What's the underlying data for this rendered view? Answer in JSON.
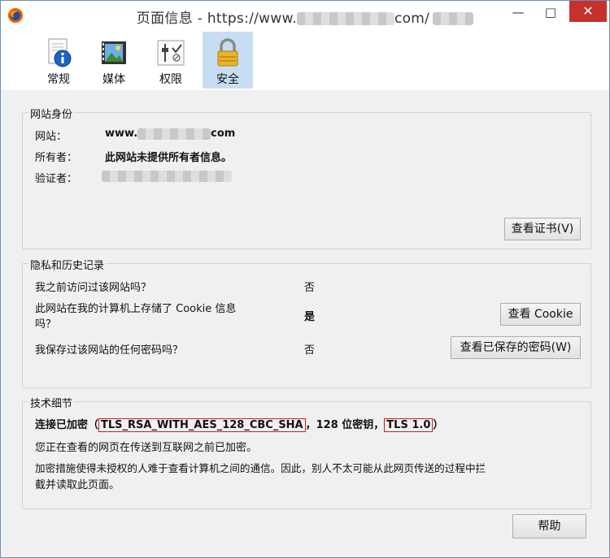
{
  "window": {
    "title_prefix": "页面信息 - https://www.",
    "title_suffix": "com/",
    "minimize": "—",
    "maximize": "□",
    "close": "✕"
  },
  "tabs": [
    {
      "label": "常规",
      "icon": "info-icon"
    },
    {
      "label": "媒体",
      "icon": "media-icon"
    },
    {
      "label": "权限",
      "icon": "permissions-icon"
    },
    {
      "label": "安全",
      "icon": "lock-icon",
      "active": true
    }
  ],
  "identity": {
    "title": "网站身份",
    "website_label": "网站：",
    "website_prefix": "www.",
    "website_suffix": "com",
    "owner_label": "所有者：",
    "owner_value": "此网站未提供所有者信息。",
    "verifier_label": "验证者：",
    "view_cert_button": "查看证书(V)"
  },
  "privacy": {
    "title": "隐私和历史记录",
    "q1": "我之前访问过该网站吗？",
    "a1": "否",
    "q2_line1": "此网站在我的计算机上存储了 Cookie 信息",
    "q2_line2": "吗？",
    "a2": "是",
    "view_cookie_button": "查看 Cookie",
    "q3": "我保存过该网站的任何密码吗？",
    "a3": "否",
    "view_passwords_button": "查看已保存的密码(W)"
  },
  "tech": {
    "title": "技术细节",
    "conn_prefix": "连接已加密（",
    "cipher": "TLS_RSA_WITH_AES_128_CBC_SHA",
    "conn_mid": "，128 位密钥，",
    "protocol": "TLS 1.0",
    "conn_suffix": "）",
    "line2": "您正在查看的网页在传送到互联网之前已加密。",
    "line3": "加密措施使得未授权的人难于查看计算机之间的通信。因此，别人不太可能从此网页传送的过程中拦",
    "line4": "截并读取此页面。"
  },
  "help_button": "帮助",
  "colors": {
    "close_button": "#c7312c",
    "active_tab": "#c7ddf3",
    "highlight_box": "#d21e1e"
  }
}
